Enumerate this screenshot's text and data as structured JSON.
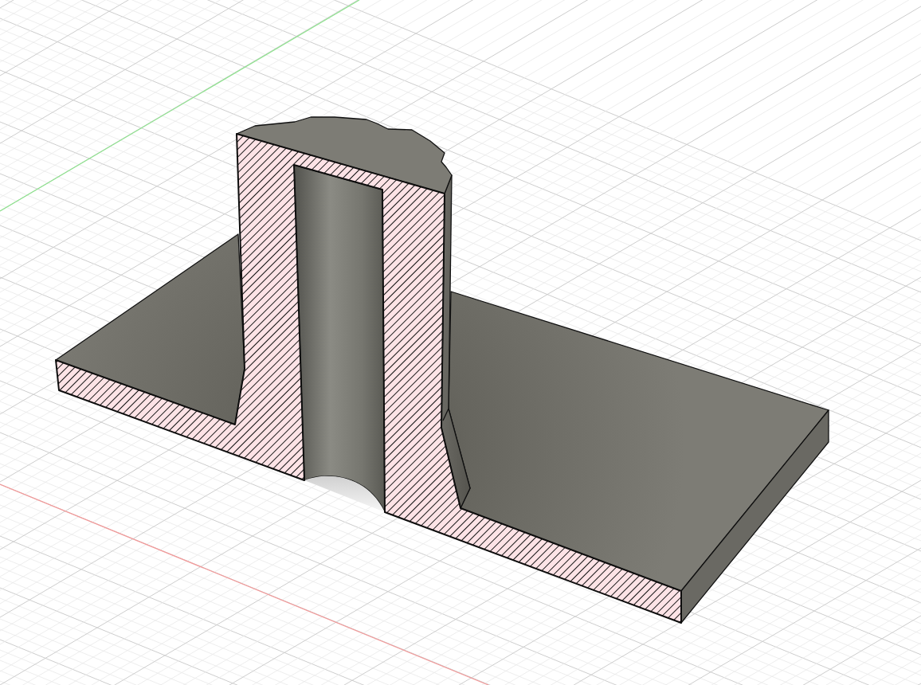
{
  "viewport": {
    "grid": true,
    "section_cut": true,
    "axis_lines": [
      {
        "color": "#f29a9a"
      },
      {
        "color": "#8fe38f"
      }
    ]
  }
}
